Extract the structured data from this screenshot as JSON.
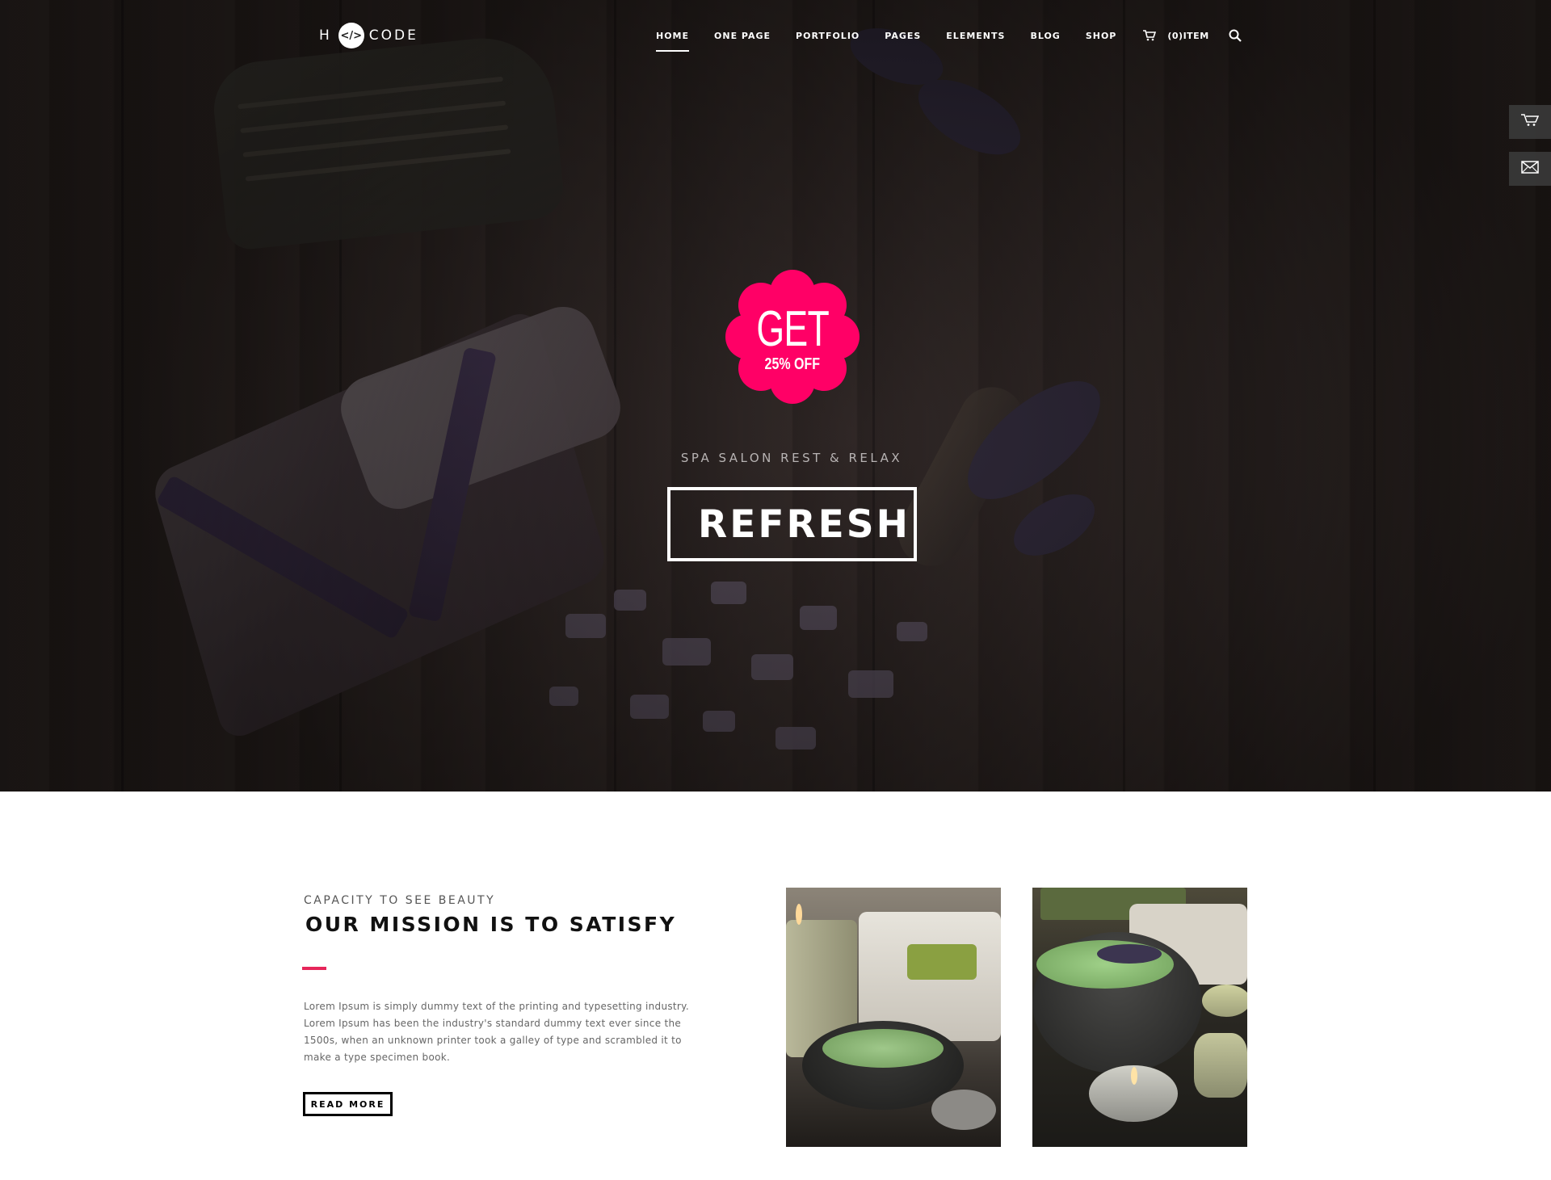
{
  "brand": {
    "left": "H",
    "mark": "</>",
    "right": "CODE"
  },
  "nav": {
    "items": [
      "HOME",
      "ONE PAGE",
      "PORTFOLIO",
      "PAGES",
      "ELEMENTS",
      "BLOG",
      "SHOP"
    ],
    "active": "HOME",
    "cart_label": "(0)ITEM"
  },
  "side_tabs": {
    "cart_icon": "cart-icon",
    "mail_icon": "mail-icon"
  },
  "hero": {
    "badge_get": "GET",
    "badge_offer": "25% OFF",
    "subtitle": "SPA SALON REST & RELAX",
    "title": "REFRESH"
  },
  "mission": {
    "eyebrow": "CAPACITY TO SEE BEAUTY",
    "heading": "OUR MISSION IS TO SATISFY",
    "body": "Lorem Ipsum is simply dummy text of the printing and typesetting industry. Lorem Ipsum has been the industry's standard dummy text ever since the 1500s, when an unknown printer took a galley of type and scrambled it to make a type specimen book.",
    "button": "READ MORE"
  },
  "colors": {
    "accent": "#e6265a",
    "badge": "#ff0066"
  }
}
